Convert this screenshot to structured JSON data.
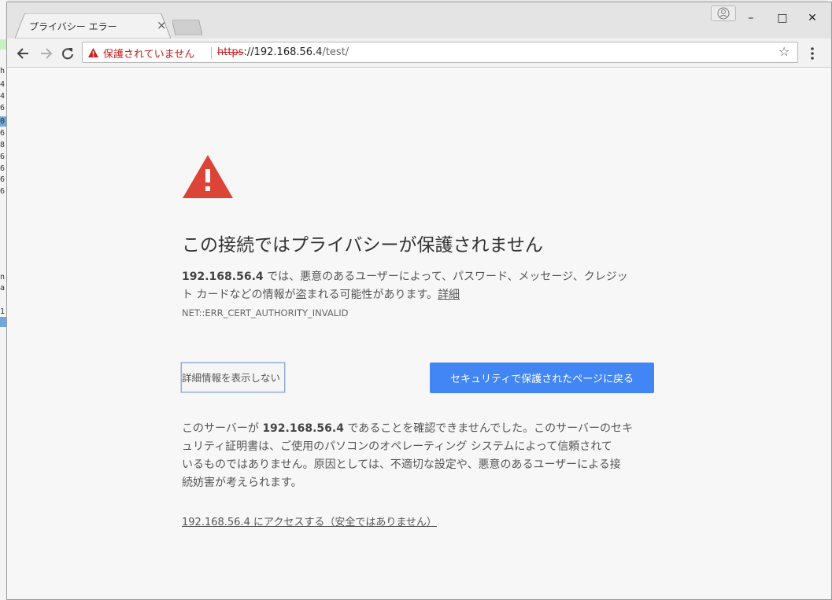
{
  "tab": {
    "title": "プライバシー エラー",
    "close": "×"
  },
  "window_controls": {
    "minimize": "–",
    "maximize": "□",
    "close": "✕"
  },
  "toolbar": {
    "security_label": "保護されていません",
    "url_scheme": "https",
    "url_host": "://192.168.56.4",
    "url_path": "/test/",
    "star": "☆"
  },
  "page": {
    "heading": "この接続ではプライバシーが保護されません",
    "intro_host": "192.168.56.4",
    "intro_line1_rest": " では、悪意のあるユーザーによって、パスワード、メッセージ、クレジッ",
    "intro_line2": "ト カードなどの情報が盗まれる可能性があります。",
    "intro_link": "詳細",
    "error_code": "NET::ERR_CERT_AUTHORITY_INVALID",
    "details_button": "詳細情報を表示しない",
    "back_button": "セキュリティで保護されたページに戻る",
    "explain_prefix": "このサーバーが ",
    "explain_host": "192.168.56.4",
    "explain_rest_line1": " であることを確認できませんでした。このサーバーのセキ",
    "explain_line2": "ュリティ証明書は、ご使用のパソコンのオペレーティング システムによって信頼されて",
    "explain_line3": "いるものではありません。原因としては、不適切な設定や、悪意のあるユーザーによる接",
    "explain_line4": "続妨害が考えられます。",
    "proceed_link": "192.168.56.4 にアクセスする（安全ではありません）"
  },
  "background": {
    "side_numbers": [
      "h",
      "4",
      "4",
      "6",
      "0",
      "6",
      "8",
      "6",
      "6",
      "6",
      "6",
      "n",
      "a",
      "1"
    ]
  },
  "colors": {
    "accent": "#4285f4",
    "danger": "#c5221f",
    "warning_icon": "#db4437"
  }
}
